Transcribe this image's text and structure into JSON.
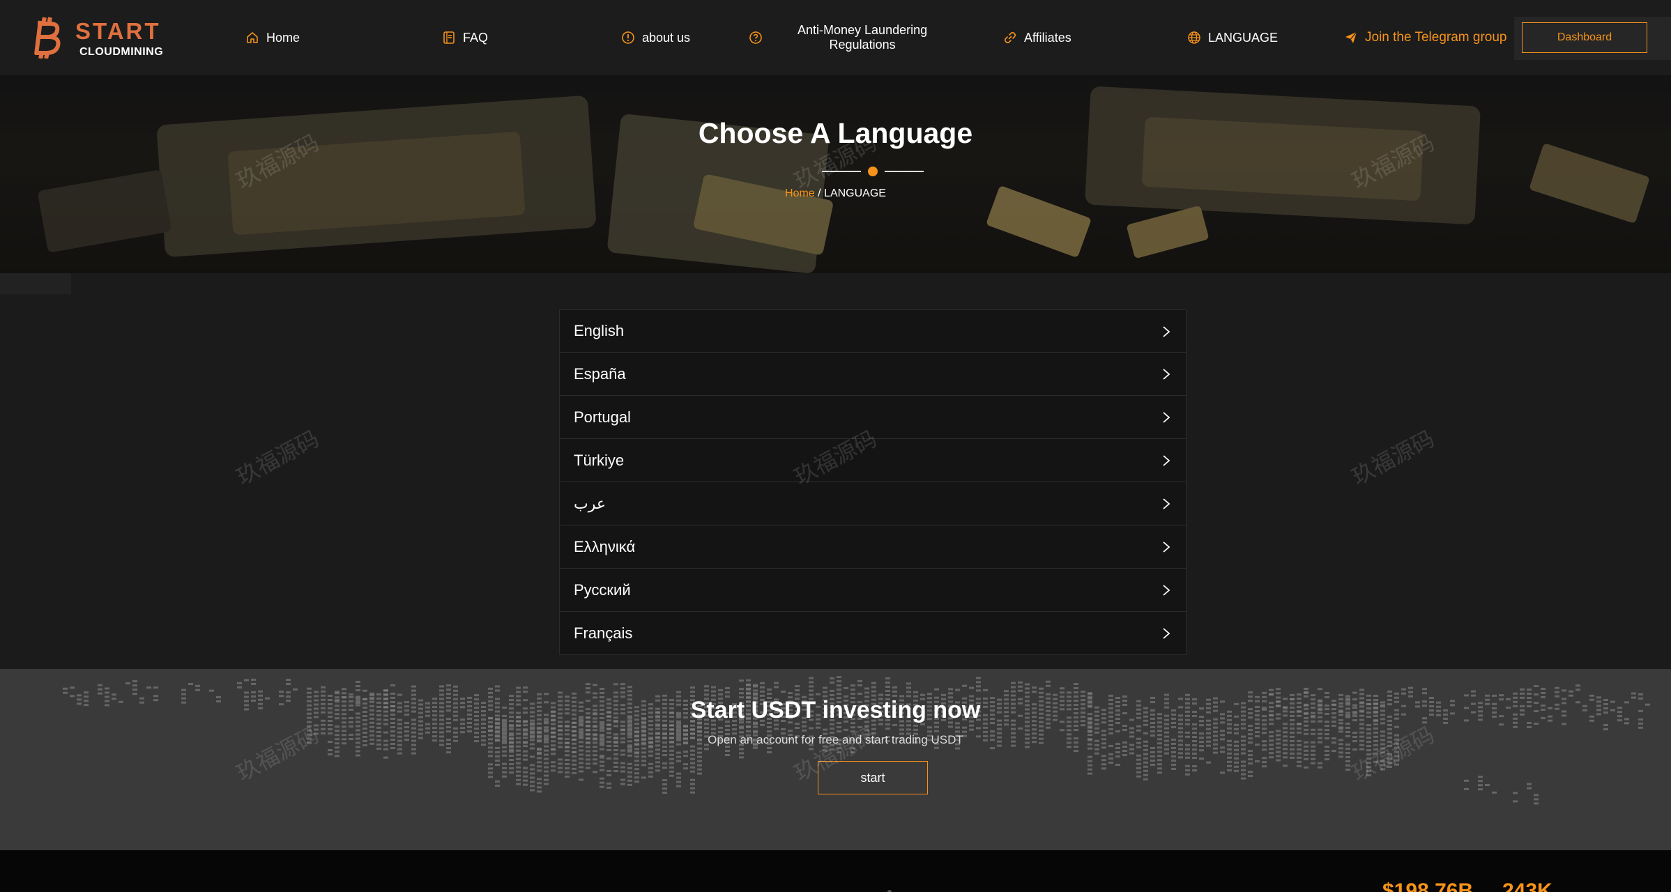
{
  "brand": {
    "word1": "START",
    "word2": "CLOUDMINING"
  },
  "nav": {
    "home": "Home",
    "faq": "FAQ",
    "about": "about us",
    "aml_line1": "Anti-Money Laundering",
    "aml_line2": "Regulations",
    "affiliates": "Affiliates",
    "language": "LANGUAGE",
    "telegram": "Join the Telegram group",
    "dashboard": "Dashboard"
  },
  "hero": {
    "title": "Choose A Language",
    "breadcrumb_home": "Home",
    "breadcrumb_sep": " / ",
    "breadcrumb_current": "LANGUAGE"
  },
  "languages": [
    "English",
    "España",
    "Portugal",
    "Türkiye",
    "عرب",
    "Ελληνικά",
    "Русский",
    "Français"
  ],
  "cta": {
    "title": "Start USDT investing now",
    "subtitle": "Open an account for free and start trading USDT",
    "button": "start"
  },
  "stats": {
    "stat1": "$198.76B",
    "stat2": "243K"
  },
  "watermark": "玖福源码",
  "colors": {
    "accent": "#f6931a",
    "logo": "#e0703f",
    "header_bg": "#1c1c1c",
    "row_bg": "#141414"
  }
}
